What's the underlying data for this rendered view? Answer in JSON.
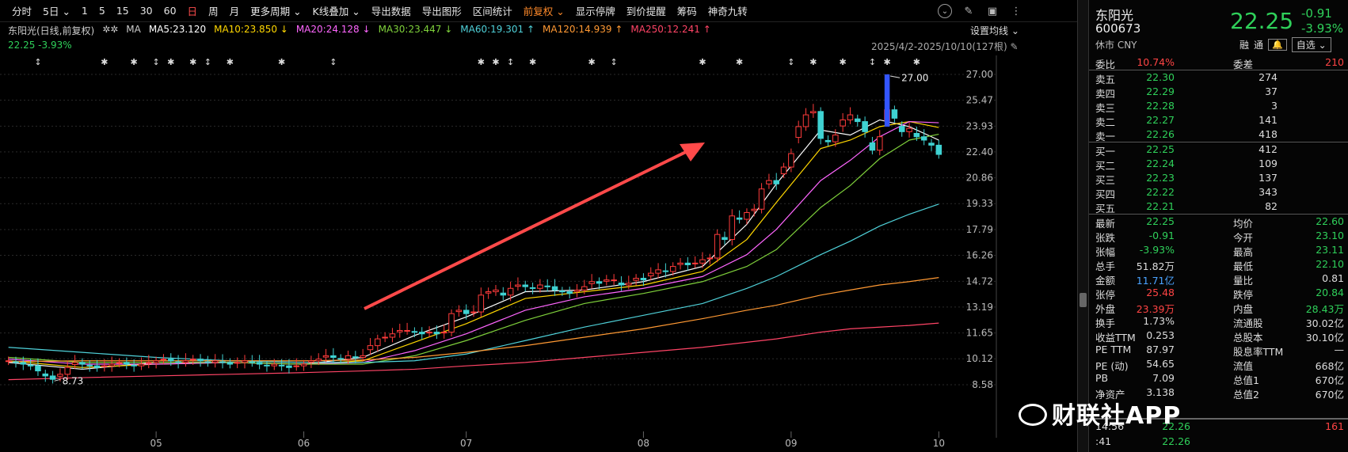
{
  "toolbar": {
    "items": [
      "分时",
      "5日",
      "1",
      "5",
      "15",
      "30",
      "60",
      "日",
      "周",
      "月",
      "更多周期",
      "K线叠加",
      "导出数据",
      "导出图形",
      "区间统计",
      "前复权",
      "显示停牌",
      "到价提醒",
      "筹码",
      "神奇九转"
    ],
    "active_index": 7,
    "orange_index": 15,
    "dropdown_marks": [
      1,
      10,
      11,
      15
    ]
  },
  "header": {
    "stock_label": "东阳光(日线,前复权)",
    "ma_label": "MA",
    "ma": [
      {
        "text": "MA5:23.120",
        "arrow": "",
        "color": "#ffffff"
      },
      {
        "text": "MA10:23.850",
        "arrow": "↓",
        "color": "#ffd700"
      },
      {
        "text": "MA20:24.128",
        "arrow": "↓",
        "color": "#ff66ff"
      },
      {
        "text": "MA30:23.447",
        "arrow": "↓",
        "color": "#7fd13b"
      },
      {
        "text": "MA60:19.301",
        "arrow": "↑",
        "color": "#4fd1d9"
      },
      {
        "text": "MA120:14.939",
        "arrow": "↑",
        "color": "#ff9933"
      },
      {
        "text": "MA250:12.241",
        "arrow": "↑",
        "color": "#ff4466"
      }
    ],
    "last_line": "22.25  -3.93%",
    "set_ma": "设置均线",
    "date_range": "2025/4/2-2025/10/10(127根)"
  },
  "chart_data": {
    "type": "candlestick",
    "y_ticks": [
      "27.00",
      "25.47",
      "23.93",
      "22.40",
      "20.86",
      "19.33",
      "17.79",
      "16.26",
      "14.72",
      "13.19",
      "11.65",
      "10.12",
      "8.58"
    ],
    "ylim": [
      8.58,
      27.0
    ],
    "x_ticks": [
      "05",
      "06",
      "07",
      "08",
      "09",
      "10"
    ],
    "x_tick_positions": [
      20,
      40,
      62,
      86,
      106,
      126
    ],
    "max_label": "27.00",
    "min_label": "8.73",
    "n": 127,
    "closes": [
      10.0,
      9.9,
      9.8,
      9.7,
      9.4,
      9.1,
      8.9,
      9.2,
      9.6,
      9.9,
      9.8,
      9.7,
      9.6,
      9.7,
      9.8,
      9.9,
      9.8,
      9.7,
      9.8,
      9.9,
      10.0,
      10.1,
      10.0,
      9.9,
      10.0,
      10.1,
      10.0,
      9.9,
      10.0,
      9.9,
      9.8,
      9.9,
      10.0,
      9.9,
      9.8,
      9.7,
      9.8,
      9.7,
      9.6,
      9.7,
      9.8,
      10.0,
      10.1,
      10.3,
      10.2,
      10.1,
      10.3,
      10.2,
      10.3,
      10.9,
      11.3,
      11.4,
      11.6,
      11.8,
      11.8,
      11.7,
      11.6,
      11.7,
      11.6,
      11.7,
      12.8,
      13.0,
      12.8,
      12.9,
      13.9,
      14.1,
      14.2,
      13.9,
      14.3,
      14.5,
      14.4,
      14.3,
      14.5,
      14.4,
      14.2,
      14.1,
      14.0,
      14.2,
      14.4,
      14.7,
      14.6,
      14.8,
      14.8,
      14.5,
      14.6,
      14.9,
      14.8,
      15.2,
      15.4,
      15.3,
      15.6,
      15.8,
      15.7,
      15.8,
      16.0,
      16.1,
      17.5,
      17.2,
      18.6,
      18.4,
      18.8,
      19.0,
      20.2,
      20.7,
      20.5,
      21.5,
      22.3,
      23.9,
      24.6,
      24.8,
      23.2,
      23.0,
      23.4,
      24.3,
      24.6,
      24.2,
      23.6,
      22.5,
      23.3,
      24.9,
      24.4,
      23.6,
      23.8,
      23.3,
      23.1,
      22.8,
      22.25
    ],
    "ma": {
      "MA5": {
        "color": "#ffffff",
        "points": [
          [
            0,
            9.9
          ],
          [
            10,
            9.5
          ],
          [
            20,
            9.9
          ],
          [
            30,
            9.9
          ],
          [
            40,
            9.8
          ],
          [
            48,
            10.2
          ],
          [
            55,
            11.5
          ],
          [
            62,
            12.6
          ],
          [
            70,
            14.1
          ],
          [
            78,
            14.2
          ],
          [
            86,
            14.7
          ],
          [
            94,
            15.6
          ],
          [
            100,
            18.1
          ],
          [
            104,
            20.5
          ],
          [
            110,
            23.7
          ],
          [
            114,
            23.4
          ],
          [
            118,
            24.3
          ],
          [
            122,
            23.9
          ],
          [
            126,
            23.1
          ]
        ]
      },
      "MA10": {
        "color": "#ffd700",
        "points": [
          [
            0,
            10.0
          ],
          [
            10,
            9.6
          ],
          [
            20,
            9.8
          ],
          [
            30,
            9.9
          ],
          [
            40,
            9.8
          ],
          [
            48,
            10.0
          ],
          [
            55,
            11.1
          ],
          [
            62,
            12.2
          ],
          [
            70,
            13.7
          ],
          [
            78,
            14.1
          ],
          [
            86,
            14.5
          ],
          [
            94,
            15.3
          ],
          [
            100,
            17.2
          ],
          [
            104,
            19.4
          ],
          [
            110,
            22.6
          ],
          [
            114,
            23.1
          ],
          [
            118,
            23.9
          ],
          [
            122,
            24.2
          ],
          [
            126,
            23.85
          ]
        ]
      },
      "MA20": {
        "color": "#ff66ff",
        "points": [
          [
            0,
            10.1
          ],
          [
            10,
            9.8
          ],
          [
            20,
            9.8
          ],
          [
            30,
            9.9
          ],
          [
            40,
            9.8
          ],
          [
            48,
            9.9
          ],
          [
            55,
            10.6
          ],
          [
            62,
            11.6
          ],
          [
            70,
            13.0
          ],
          [
            78,
            13.8
          ],
          [
            86,
            14.3
          ],
          [
            94,
            15.0
          ],
          [
            100,
            16.3
          ],
          [
            104,
            17.8
          ],
          [
            110,
            20.7
          ],
          [
            114,
            21.9
          ],
          [
            118,
            23.3
          ],
          [
            122,
            24.2
          ],
          [
            126,
            24.13
          ]
        ]
      },
      "MA30": {
        "color": "#7fd13b",
        "points": [
          [
            0,
            10.2
          ],
          [
            10,
            9.9
          ],
          [
            20,
            9.9
          ],
          [
            30,
            9.9
          ],
          [
            40,
            9.8
          ],
          [
            48,
            9.8
          ],
          [
            55,
            10.3
          ],
          [
            62,
            11.2
          ],
          [
            70,
            12.4
          ],
          [
            78,
            13.4
          ],
          [
            86,
            14.0
          ],
          [
            94,
            14.7
          ],
          [
            100,
            15.6
          ],
          [
            104,
            16.6
          ],
          [
            110,
            19.1
          ],
          [
            114,
            20.4
          ],
          [
            118,
            22.0
          ],
          [
            122,
            23.1
          ],
          [
            126,
            23.45
          ]
        ]
      },
      "MA60": {
        "color": "#4fd1d9",
        "points": [
          [
            0,
            10.8
          ],
          [
            10,
            10.5
          ],
          [
            20,
            10.2
          ],
          [
            30,
            10.0
          ],
          [
            40,
            9.9
          ],
          [
            48,
            9.9
          ],
          [
            55,
            10.0
          ],
          [
            62,
            10.4
          ],
          [
            70,
            11.2
          ],
          [
            78,
            12.0
          ],
          [
            86,
            12.7
          ],
          [
            94,
            13.4
          ],
          [
            100,
            14.3
          ],
          [
            104,
            15.0
          ],
          [
            110,
            16.3
          ],
          [
            114,
            17.1
          ],
          [
            118,
            18.0
          ],
          [
            122,
            18.7
          ],
          [
            126,
            19.3
          ]
        ]
      },
      "MA120": {
        "color": "#ff9933",
        "points": [
          [
            0,
            9.95
          ],
          [
            10,
            10.0
          ],
          [
            20,
            10.0
          ],
          [
            30,
            10.0
          ],
          [
            40,
            10.0
          ],
          [
            48,
            10.05
          ],
          [
            55,
            10.2
          ],
          [
            62,
            10.5
          ],
          [
            70,
            10.9
          ],
          [
            78,
            11.4
          ],
          [
            86,
            11.9
          ],
          [
            94,
            12.5
          ],
          [
            100,
            13.0
          ],
          [
            104,
            13.3
          ],
          [
            110,
            13.9
          ],
          [
            114,
            14.2
          ],
          [
            118,
            14.5
          ],
          [
            122,
            14.7
          ],
          [
            126,
            14.94
          ]
        ]
      },
      "MA250": {
        "color": "#ff4466",
        "points": [
          [
            0,
            8.88
          ],
          [
            10,
            9.0
          ],
          [
            20,
            9.1
          ],
          [
            30,
            9.2
          ],
          [
            40,
            9.3
          ],
          [
            48,
            9.4
          ],
          [
            55,
            9.5
          ],
          [
            62,
            9.7
          ],
          [
            70,
            9.9
          ],
          [
            78,
            10.2
          ],
          [
            86,
            10.5
          ],
          [
            94,
            10.8
          ],
          [
            100,
            11.1
          ],
          [
            104,
            11.3
          ],
          [
            110,
            11.7
          ],
          [
            114,
            11.9
          ],
          [
            118,
            12.0
          ],
          [
            122,
            12.1
          ],
          [
            126,
            12.24
          ]
        ]
      }
    }
  },
  "panel": {
    "name": "东阳光",
    "code": "600673",
    "market": "休市 CNY",
    "price": "22.25",
    "change": "-0.91",
    "change_pct": "-3.93%",
    "btn_rong": "融",
    "btn_tong": "通",
    "btn_bell": "🔔",
    "btn_zixuan": "自选",
    "weibi": {
      "label": "委比",
      "value": "10.74%",
      "label2": "委差",
      "value2": "210"
    },
    "sells": [
      {
        "label": "卖五",
        "price": "22.30",
        "vol": "274"
      },
      {
        "label": "卖四",
        "price": "22.29",
        "vol": "37"
      },
      {
        "label": "卖三",
        "price": "22.28",
        "vol": "3"
      },
      {
        "label": "卖二",
        "price": "22.27",
        "vol": "141"
      },
      {
        "label": "卖一",
        "price": "22.26",
        "vol": "418"
      }
    ],
    "buys": [
      {
        "label": "买一",
        "price": "22.25",
        "vol": "412"
      },
      {
        "label": "买二",
        "price": "22.24",
        "vol": "109"
      },
      {
        "label": "买三",
        "price": "22.23",
        "vol": "137"
      },
      {
        "label": "买四",
        "price": "22.22",
        "vol": "343"
      },
      {
        "label": "买五",
        "price": "22.21",
        "vol": "82"
      }
    ],
    "stats": [
      {
        "l1": "最新",
        "v1": "22.25",
        "c1": "green",
        "l2": "均价",
        "v2": "22.60",
        "c2": "green"
      },
      {
        "l1": "张跌",
        "v1": "-0.91",
        "c1": "green",
        "l2": "今开",
        "v2": "23.10",
        "c2": "green"
      },
      {
        "l1": "张幅",
        "v1": "-3.93%",
        "c1": "green",
        "l2": "最高",
        "v2": "23.11",
        "c2": "green"
      },
      {
        "l1": "总手",
        "v1": "51.82万",
        "c1": "white",
        "l2": "最低",
        "v2": "22.10",
        "c2": "green"
      },
      {
        "l1": "金额",
        "v1": "11.71亿",
        "c1": "blue",
        "l2": "量比",
        "v2": "0.81",
        "c2": "white"
      },
      {
        "l1": "张停",
        "v1": "25.48",
        "c1": "red",
        "l2": "跌停",
        "v2": "20.84",
        "c2": "green"
      },
      {
        "l1": "外盘",
        "v1": "23.39万",
        "c1": "red",
        "l2": "内盘",
        "v2": "28.43万",
        "c2": "green"
      },
      {
        "l1": "换手",
        "v1": "1.73%",
        "c1": "white",
        "l2": "流通股",
        "v2": "30.02亿",
        "c2": "white"
      },
      {
        "l1": "收益TTM",
        "v1": "0.253",
        "c1": "white",
        "l2": "总股本",
        "v2": "30.10亿",
        "c2": "white"
      },
      {
        "l1": "PE TTM",
        "v1": "87.97",
        "c1": "white",
        "l2": "股息率TTM",
        "v2": "—",
        "c2": "white"
      },
      {
        "l1": "PE (动)",
        "v1": "54.65",
        "c1": "white",
        "l2": "流值",
        "v2": "668亿",
        "c2": "white"
      },
      {
        "l1": "PB",
        "v1": "7.09",
        "c1": "white",
        "l2": "总值1",
        "v2": "670亿",
        "c2": "white"
      },
      {
        "l1": "净资产",
        "v1": "3.138",
        "c1": "white",
        "l2": "总值2",
        "v2": "670亿",
        "c2": "white"
      }
    ],
    "ticks": [
      {
        "time": "14:56",
        "price": "22.26",
        "vol": "161"
      },
      {
        "time": ":41",
        "price": "22.26",
        "vol": ""
      }
    ]
  },
  "watermark": "财联社APP"
}
